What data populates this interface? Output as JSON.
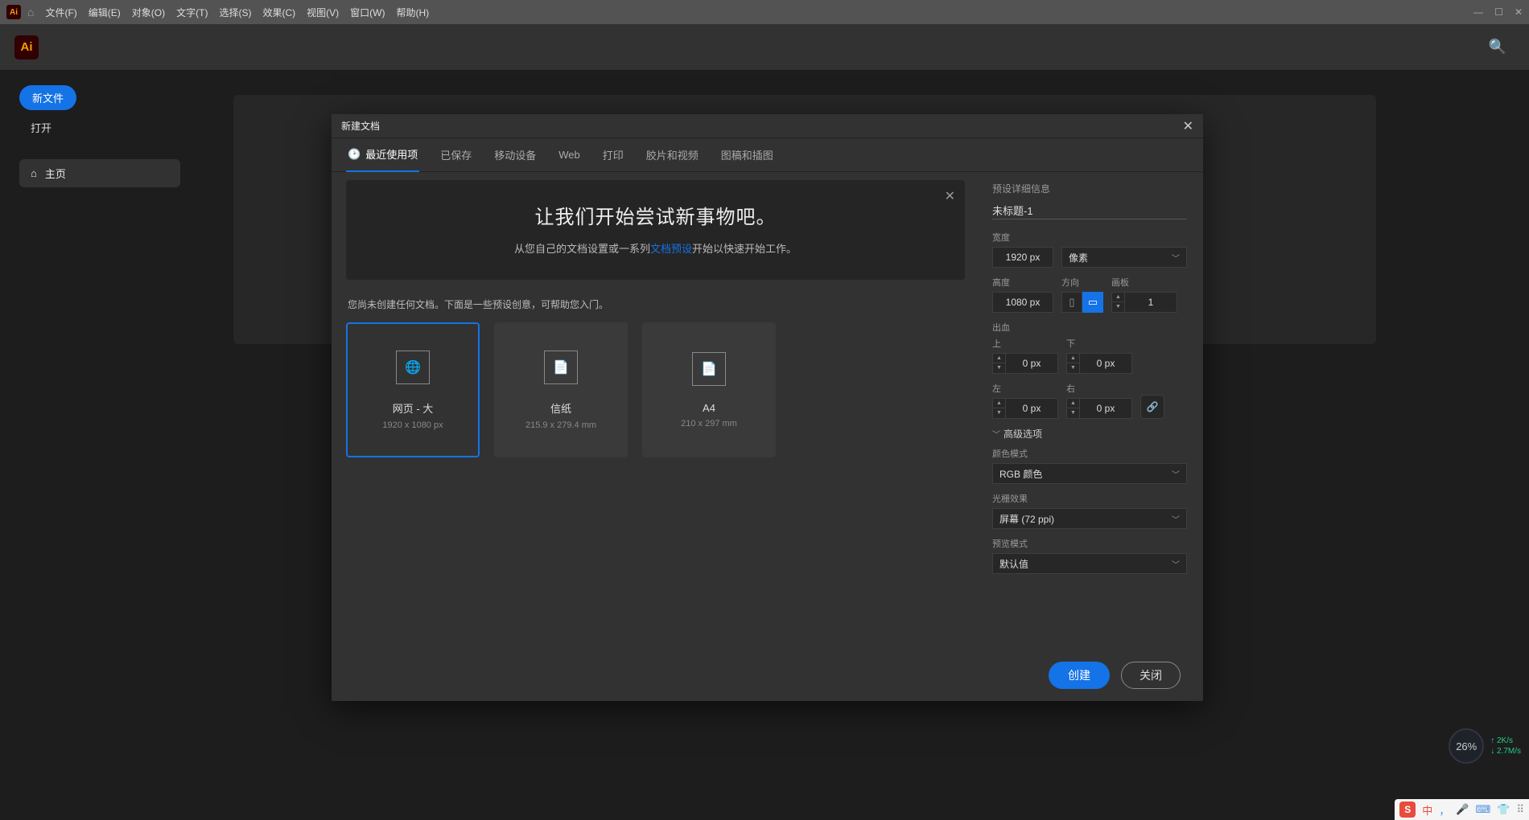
{
  "menubar": {
    "items": [
      "文件(F)",
      "编辑(E)",
      "对象(O)",
      "文字(T)",
      "选择(S)",
      "效果(C)",
      "视图(V)",
      "窗口(W)",
      "帮助(H)"
    ]
  },
  "sidebar": {
    "new_file": "新文件",
    "open": "打开",
    "home": "主页"
  },
  "dialog": {
    "title": "新建文档",
    "tabs": [
      "最近使用项",
      "已保存",
      "移动设备",
      "Web",
      "打印",
      "胶片和视频",
      "图稿和插图"
    ],
    "hero_title": "让我们开始尝试新事物吧。",
    "hero_text_pre": "从您自己的文档设置或一系列",
    "hero_link": "文档预设",
    "hero_text_post": "开始以快速开始工作。",
    "presets_caption": "您尚未创建任何文档。下面是一些预设创意，可帮助您入门。",
    "presets": [
      {
        "title": "网页 - 大",
        "sub": "1920 x 1080 px"
      },
      {
        "title": "信纸",
        "sub": "215.9 x 279.4 mm"
      },
      {
        "title": "A4",
        "sub": "210 x 297 mm"
      }
    ]
  },
  "details": {
    "section": "预设详细信息",
    "name": "未标题-1",
    "width_label": "宽度",
    "width": "1920 px",
    "unit": "像素",
    "height_label": "高度",
    "height": "1080 px",
    "orient_label": "方向",
    "artboard_label": "画板",
    "artboards": "1",
    "bleed_label": "出血",
    "top": "上",
    "bottom": "下",
    "left": "左",
    "right": "右",
    "bleed_val": "0 px",
    "advanced": "高级选项",
    "color_mode_label": "颜色模式",
    "color_mode": "RGB 颜色",
    "raster_label": "光栅效果",
    "raster": "屏幕 (72 ppi)",
    "preview_label": "预览模式",
    "preview": "默认值"
  },
  "footer": {
    "create": "创建",
    "close": "关闭"
  },
  "net": {
    "pct": "26%",
    "up": "2K/s",
    "down": "2.7M/s"
  },
  "ime": {
    "lang": "中"
  }
}
